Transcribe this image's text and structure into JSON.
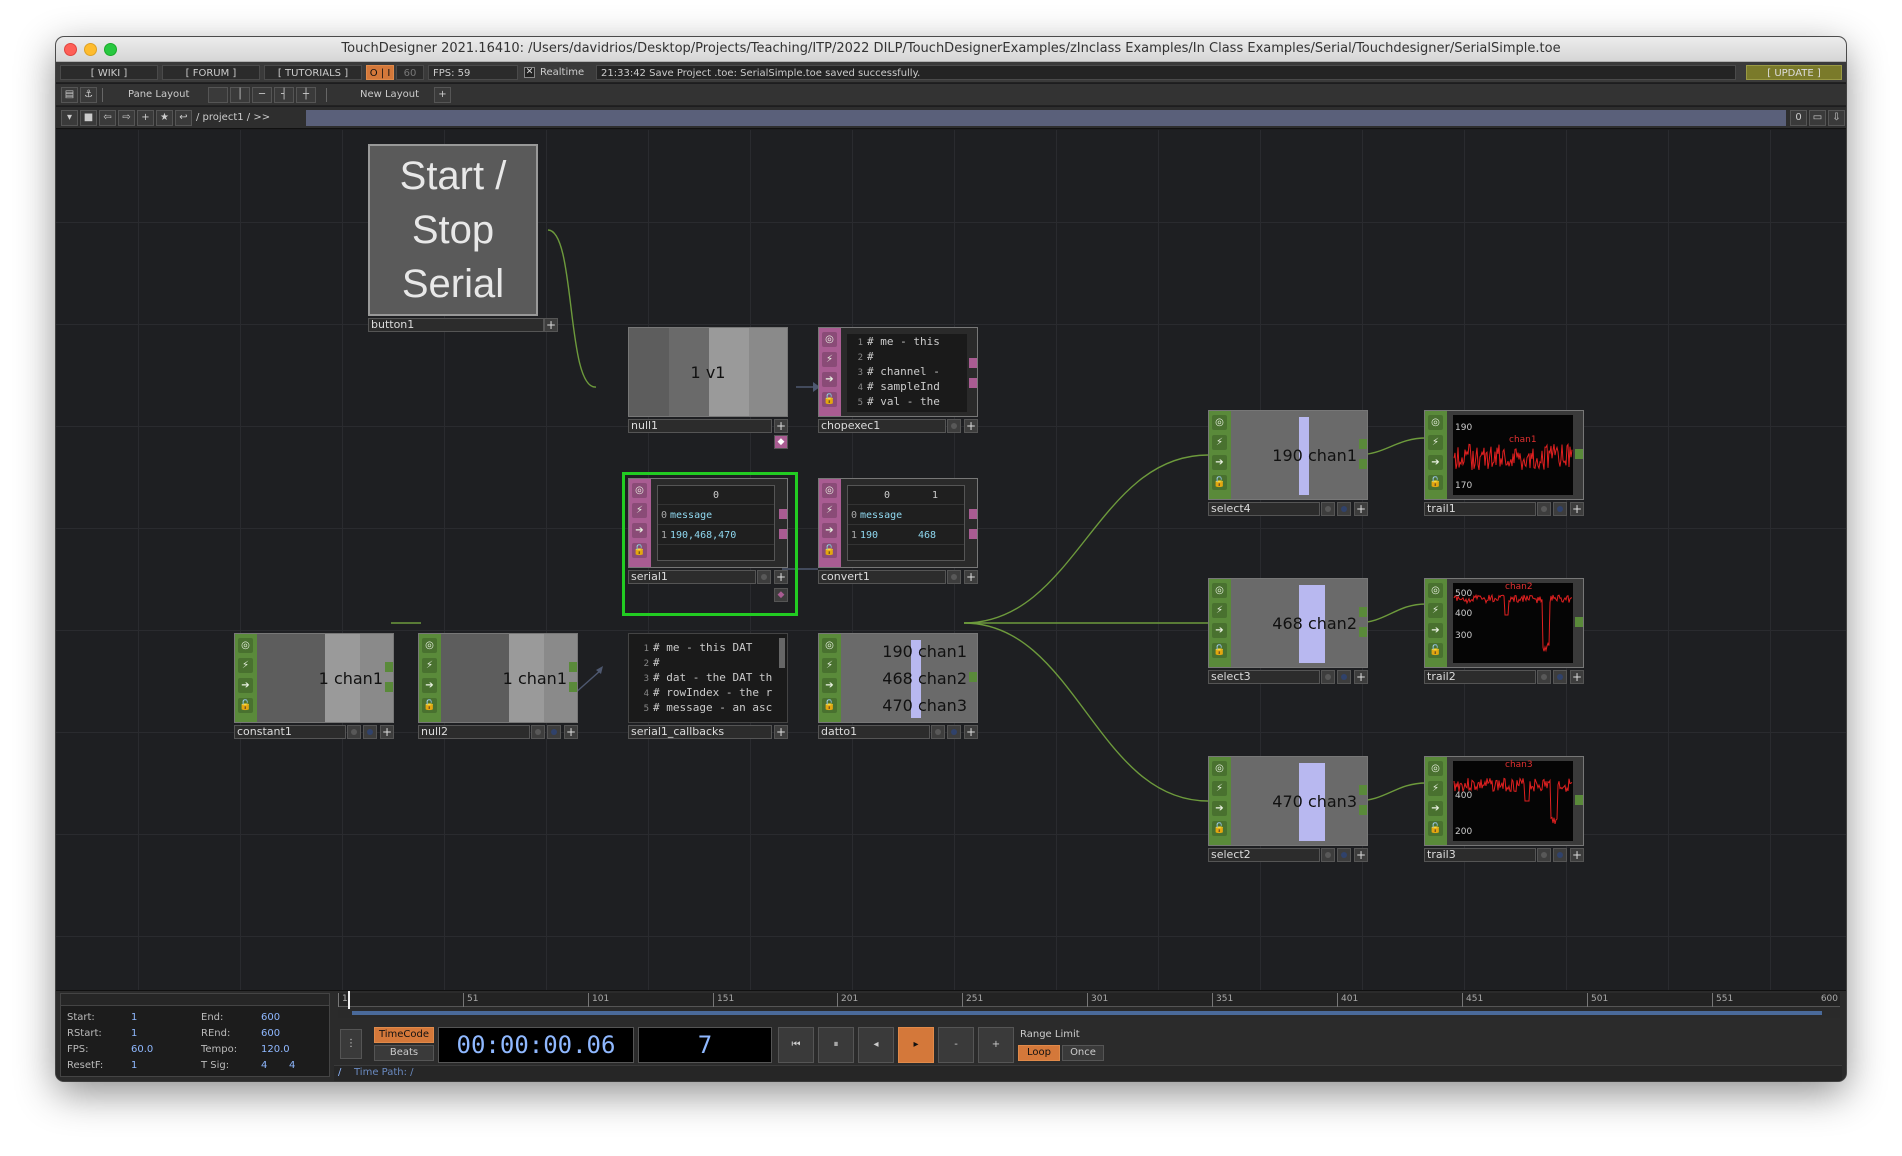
{
  "window": {
    "title": "TouchDesigner 2021.16410: /Users/davidrios/Desktop/Projects/Teaching/ITP/2022 DILP/TouchDesignerExamples/zInclass Examples/In Class Examples/Serial/Touchdesigner/SerialSimple.toe"
  },
  "menubar": {
    "wiki": "[ WIKI ]",
    "forum": "[ FORUM ]",
    "tutorials": "[ TUTORIALS ]",
    "oi": "O | I",
    "fps_target": "60",
    "fps": "FPS:  59",
    "realtime": "Realtime",
    "status": "21:33:42 Save Project .toe: SerialSimple.toe saved successfully.",
    "update": "[ UPDATE ]"
  },
  "layoutbar": {
    "pane_layout": "Pane Layout",
    "new_layout": "New Layout"
  },
  "pathbar": {
    "path": "/ project1 / >>",
    "counter": "0"
  },
  "nodes": {
    "button1": {
      "label": "button1",
      "text": [
        "Start /",
        "Stop",
        "Serial"
      ]
    },
    "null1": {
      "label": "null1",
      "value": "1",
      "channel": "v1"
    },
    "chopexec1": {
      "label": "chopexec1",
      "lines": [
        "# me - this",
        "#",
        "# channel -",
        "# sampleInd",
        "# val - the"
      ]
    },
    "serial1": {
      "label": "serial1",
      "header": "0",
      "rows": [
        {
          "idx": "0",
          "val": "message"
        },
        {
          "idx": "1",
          "val": "190,468,470"
        }
      ]
    },
    "convert1": {
      "label": "convert1",
      "header": [
        "0",
        "1"
      ],
      "rows": [
        {
          "idx": "0",
          "a": "message",
          "b": ""
        },
        {
          "idx": "1",
          "a": "190",
          "b": "468"
        }
      ]
    },
    "serial1_callbacks": {
      "label": "serial1_callbacks",
      "lines": [
        "# me - this DAT",
        "#",
        "# dat - the DAT th",
        "# rowIndex - the r",
        "# message - an asc"
      ]
    },
    "datto1": {
      "label": "datto1",
      "channels": [
        {
          "value": "190",
          "name": "chan1"
        },
        {
          "value": "468",
          "name": "chan2"
        },
        {
          "value": "470",
          "name": "chan3"
        }
      ]
    },
    "constant1": {
      "label": "constant1",
      "value": "1",
      "channel": "chan1"
    },
    "null2": {
      "label": "null2",
      "value": "1",
      "channel": "chan1"
    },
    "select4": {
      "label": "select4",
      "value": "190",
      "channel": "chan1"
    },
    "select3": {
      "label": "select3",
      "value": "468",
      "channel": "chan2"
    },
    "select2": {
      "label": "select2",
      "value": "470",
      "channel": "chan3"
    },
    "trail1": {
      "label": "trail1",
      "title": "chan1",
      "ytop": "190",
      "ybot": "170"
    },
    "trail2": {
      "label": "trail2",
      "title": "chan2",
      "ytop": "500",
      "ymid": "400",
      "ybot": "300"
    },
    "trail3": {
      "label": "trail3",
      "title": "chan3",
      "ytop": "400",
      "ybot": "200"
    }
  },
  "timeline": {
    "ticks": [
      "1",
      "51",
      "101",
      "151",
      "201",
      "251",
      "301",
      "351",
      "401",
      "451",
      "501",
      "551",
      "600"
    ],
    "info": {
      "start_label": "Start:",
      "start": "1",
      "end_label": "End:",
      "end": "600",
      "rstart_label": "RStart:",
      "rstart": "1",
      "rend_label": "REnd:",
      "rend": "600",
      "fps_label": "FPS:",
      "fps": "60.0",
      "tempo_label": "Tempo:",
      "tempo": "120.0",
      "resetf_label": "ResetF:",
      "resetf": "1",
      "tsig_label": "T Sig:",
      "tsig_a": "4",
      "tsig_b": "4"
    },
    "timecode_tab": "TimeCode",
    "beats_tab": "Beats",
    "time_display": "00:00:00.06",
    "frame_display": "7",
    "range_limit": "Range Limit",
    "loop": "Loop",
    "once": "Once",
    "timepath_slash": "/",
    "timepath": "Time Path: /"
  },
  "colors": {
    "chop": "#5a8a3a",
    "dat": "#a95c92",
    "selected": "#22cc22",
    "wire": "#6d9a3c",
    "accent": "#d4783a"
  }
}
